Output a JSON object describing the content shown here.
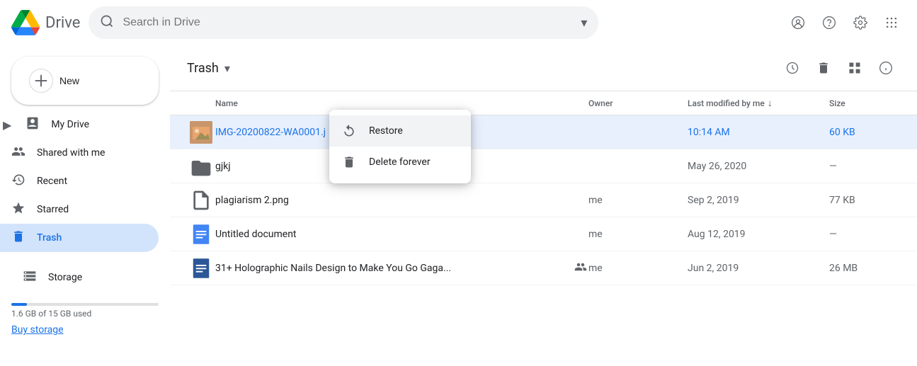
{
  "app": {
    "title": "Drive",
    "logo_text": "Drive"
  },
  "search": {
    "placeholder": "Search in Drive"
  },
  "new_button": {
    "label": "New"
  },
  "sidebar": {
    "items": [
      {
        "id": "my-drive",
        "label": "My Drive",
        "icon": "📁",
        "active": false
      },
      {
        "id": "shared-with-me",
        "label": "Shared with me",
        "icon": "👥",
        "active": false
      },
      {
        "id": "recent",
        "label": "Recent",
        "icon": "🕐",
        "active": false
      },
      {
        "id": "starred",
        "label": "Starred",
        "icon": "⭐",
        "active": false
      },
      {
        "id": "trash",
        "label": "Trash",
        "icon": "🗑️",
        "active": true
      }
    ],
    "storage": {
      "label": "Storage",
      "used": "1.6 GB of 15 GB used",
      "percent": 10.67,
      "buy_label": "Buy storage"
    }
  },
  "content": {
    "title": "Trash",
    "columns": {
      "name": "Name",
      "owner": "Owner",
      "last_modified": "Last modified by me",
      "size": "Size"
    },
    "files": [
      {
        "id": "img-file",
        "name": "IMG-20200822-WA0001.j",
        "type": "image",
        "owner": "",
        "modified": "10:14 AM",
        "size": "60 KB",
        "selected": true,
        "shared": false
      },
      {
        "id": "gjkj-folder",
        "name": "gjkj",
        "type": "folder",
        "owner": "",
        "modified": "May 26, 2020",
        "size": "—",
        "selected": false,
        "shared": false
      },
      {
        "id": "plagiarism-file",
        "name": "plagiarism 2.png",
        "type": "png",
        "owner": "me",
        "modified": "Sep 2, 2019",
        "size": "77 KB",
        "selected": false,
        "shared": false
      },
      {
        "id": "untitled-doc",
        "name": "Untitled document",
        "type": "doc",
        "owner": "me",
        "modified": "Aug 12, 2019",
        "size": "—",
        "selected": false,
        "shared": false
      },
      {
        "id": "holographic-nails",
        "name": "31+ Holographic Nails Design to Make You Go Gaga...",
        "type": "doc-word",
        "owner": "me",
        "modified": "Jun 2, 2019",
        "size": "26 MB",
        "selected": false,
        "shared": true
      }
    ],
    "context_menu": {
      "visible": true,
      "items": [
        {
          "id": "restore",
          "label": "Restore",
          "icon": "restore"
        },
        {
          "id": "delete-forever",
          "label": "Delete forever",
          "icon": "delete"
        }
      ]
    }
  }
}
